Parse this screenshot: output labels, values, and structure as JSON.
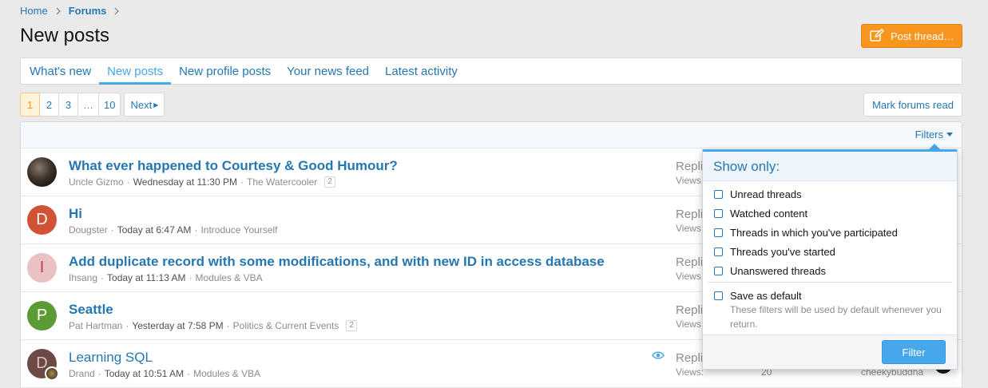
{
  "breadcrumb": {
    "home": "Home",
    "forums": "Forums"
  },
  "page": {
    "title": "New posts",
    "post_thread": "Post thread…"
  },
  "tabs": [
    "What's new",
    "New posts",
    "New profile posts",
    "Your news feed",
    "Latest activity"
  ],
  "active_tab": "New posts",
  "pager": {
    "pages": [
      "1",
      "2",
      "3",
      "…",
      "10"
    ],
    "current": "1",
    "next": "Next"
  },
  "mark_read": "Mark forums read",
  "filters_label": "Filters",
  "threads": [
    {
      "avatar_letter": "",
      "title": "What ever happened to Courtesy & Good Humour?",
      "author": "Uncle Gizmo",
      "date": "Wednesday at 11:30 PM",
      "forum": "The Watercooler",
      "pages": "2",
      "replies_label": "Repli",
      "views_label": "Views"
    },
    {
      "avatar_letter": "D",
      "title": "Hi",
      "author": "Dougster",
      "date": "Today at 6:47 AM",
      "forum": "Introduce Yourself",
      "replies_label": "Repli",
      "views_label": "Views"
    },
    {
      "avatar_letter": "I",
      "title": "Add duplicate record with some modifications, and with new ID in access database",
      "author": "Ihsang",
      "date": "Today at 11:13 AM",
      "forum": "Modules & VBA",
      "replies_label": "Repli",
      "views_label": "Views"
    },
    {
      "avatar_letter": "P",
      "title": "Seattle",
      "author": "Pat Hartman",
      "date": "Yesterday at 7:58 PM",
      "forum": "Politics & Current Events",
      "pages": "2",
      "replies_label": "Repli",
      "views_label": "Views"
    },
    {
      "avatar_letter": "D",
      "title": "Learning SQL",
      "author": "Drand",
      "date": "Today at 10:51 AM",
      "forum": "Modules & VBA",
      "replies_label": "Repli",
      "views_label": "Views:",
      "views_value": "20",
      "last_user": "cheekybuddha"
    }
  ],
  "filter_popup": {
    "heading": "Show only:",
    "options": [
      "Unread threads",
      "Watched content",
      "Threads in which you've participated",
      "Threads you've started",
      "Unanswered threads"
    ],
    "save_default": "Save as default",
    "hint": "These filters will be used by default whenever you return.",
    "button": "Filter"
  }
}
